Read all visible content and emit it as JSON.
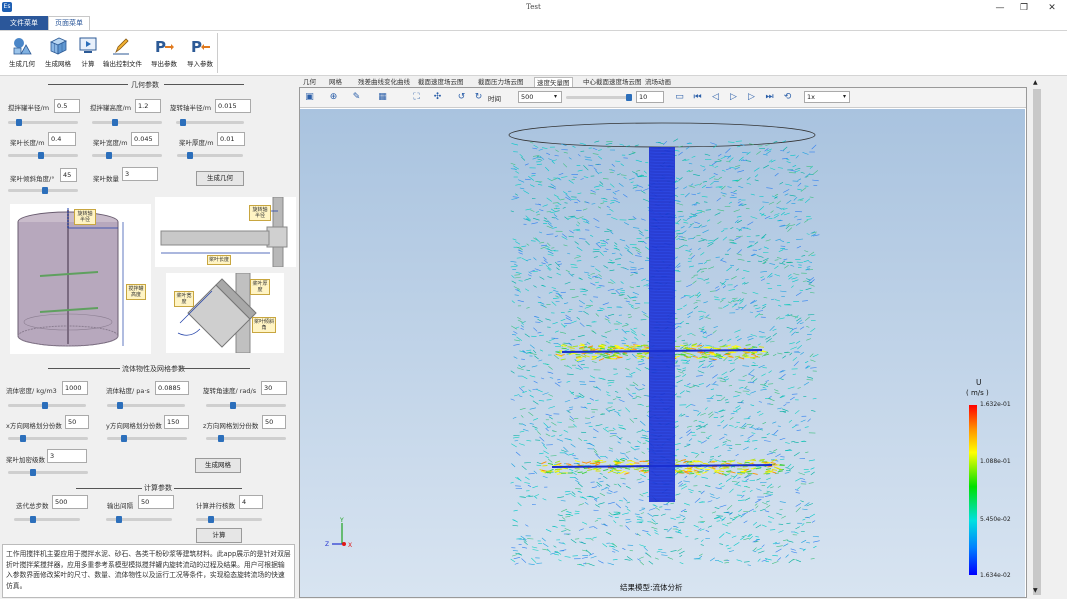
{
  "window": {
    "title": "Test",
    "app_icon": "app-icon",
    "controls": [
      "—",
      "❐",
      "✕"
    ]
  },
  "menu": {
    "tab_file": "文件菜单",
    "tab_page": "页面菜单"
  },
  "ribbon": {
    "buttons": [
      {
        "label": "生成几何",
        "icon": "geometry-icon"
      },
      {
        "label": "生成网格",
        "icon": "mesh-cube-icon"
      },
      {
        "label": "计算",
        "icon": "compute-icon"
      },
      {
        "label": "输出控制文件",
        "icon": "pencil-icon"
      },
      {
        "label": "导出参数",
        "icon": "export-params-icon"
      },
      {
        "label": "导入参数",
        "icon": "import-params-icon"
      }
    ]
  },
  "geometry": {
    "title": "几何参数",
    "tank_radius_label": "搅拌罐半径/m",
    "tank_radius_value": "0.5",
    "tank_height_label": "搅拌罐高度/m",
    "tank_height_value": "1.2",
    "shaft_radius_label": "旋转轴半径/m",
    "shaft_radius_value": "0.015",
    "blade_length_label": "桨叶长度/m",
    "blade_length_value": "0.4",
    "blade_width_label": "桨叶宽度/m",
    "blade_width_value": "0.045",
    "blade_thickness_label": "桨叶厚度/m",
    "blade_thickness_value": "0.01",
    "blade_angle_label": "桨叶倾斜角度/°",
    "blade_angle_value": "45",
    "blade_count_label": "桨叶数量",
    "blade_count_value": "3",
    "generate_button": "生成几何",
    "tags": {
      "shaft_radius": "旋转轴半径",
      "tank_radius": "搅拌罐半径",
      "tank_height": "搅拌罐高度",
      "shaft_radius_2": "旋转轴半径",
      "blade_length": "桨叶长度",
      "blade_width": "桨叶宽度",
      "blade_thickness": "桨叶厚度",
      "blade_angle": "桨叶倾斜角"
    }
  },
  "fluid": {
    "title": "流体物性及网格参数",
    "density_label": "流体密度/ kg/m3",
    "density_value": "1000",
    "viscosity_label": "流体粘度/ pa·s",
    "viscosity_value": "0.0885",
    "omega_label": "旋转角速度/ rad/s",
    "omega_value": "30",
    "x_cells_label": "x方向网格划分份数",
    "x_cells_value": "50",
    "y_cells_label": "y方向网格划分份数",
    "y_cells_value": "150",
    "z_cells_label": "z方向网格划分份数",
    "z_cells_value": "50",
    "refine_label": "桨叶加密级数",
    "refine_value": "3",
    "mesh_button": "生成网格"
  },
  "calc": {
    "title": "计算参数",
    "iterations_label": "迭代总步数",
    "iterations_value": "500",
    "output_interval_label": "输出间隔",
    "output_interval_value": "50",
    "parallel_label": "计算并行核数",
    "parallel_value": "4",
    "compute_button": "计算"
  },
  "description": "工作用搅拌机主要应用于搅拌水泥、砂石、各类干粉砂浆等建筑材料。此app展示的是针对双层折叶搅拌桨搅拌器，应用多重参考系模型模拟搅拌罐内旋转流动的过程及结果。用户可根据输入参数界面修改桨叶的尺寸、数量、流体物性以及运行工况等条件，实现稳态旋转流场的快速仿真。",
  "result_tabs": [
    "几何",
    "网格",
    "残差曲线变化曲线",
    "截面速度场云图",
    "截面压力场云图",
    "速度矢量图",
    "中心截面速度场云图",
    "流场动画"
  ],
  "active_tab_index": 5,
  "toolbar": {
    "time_label": "时间",
    "time_value": "500",
    "frame_value": "10",
    "speed_value": "1x"
  },
  "viewport": {
    "caption": "结果模型:流体分析",
    "background_top": "#a9c3df",
    "background_bottom": "#d8e4f1",
    "shaft_color": "#1a2fd0"
  },
  "legend": {
    "title": "U",
    "unit": "( m/s )",
    "max": "1.632e-01",
    "mid_high": "1.088e-01",
    "mid_low": "5.450e-02",
    "min": "1.634e-02",
    "colors": [
      "#ff0000",
      "#ffa000",
      "#ffff00",
      "#00e000",
      "#00e0e0",
      "#0080ff",
      "#0000ff"
    ]
  },
  "axes": {
    "y": "Y",
    "z": "Z",
    "x": "X"
  }
}
